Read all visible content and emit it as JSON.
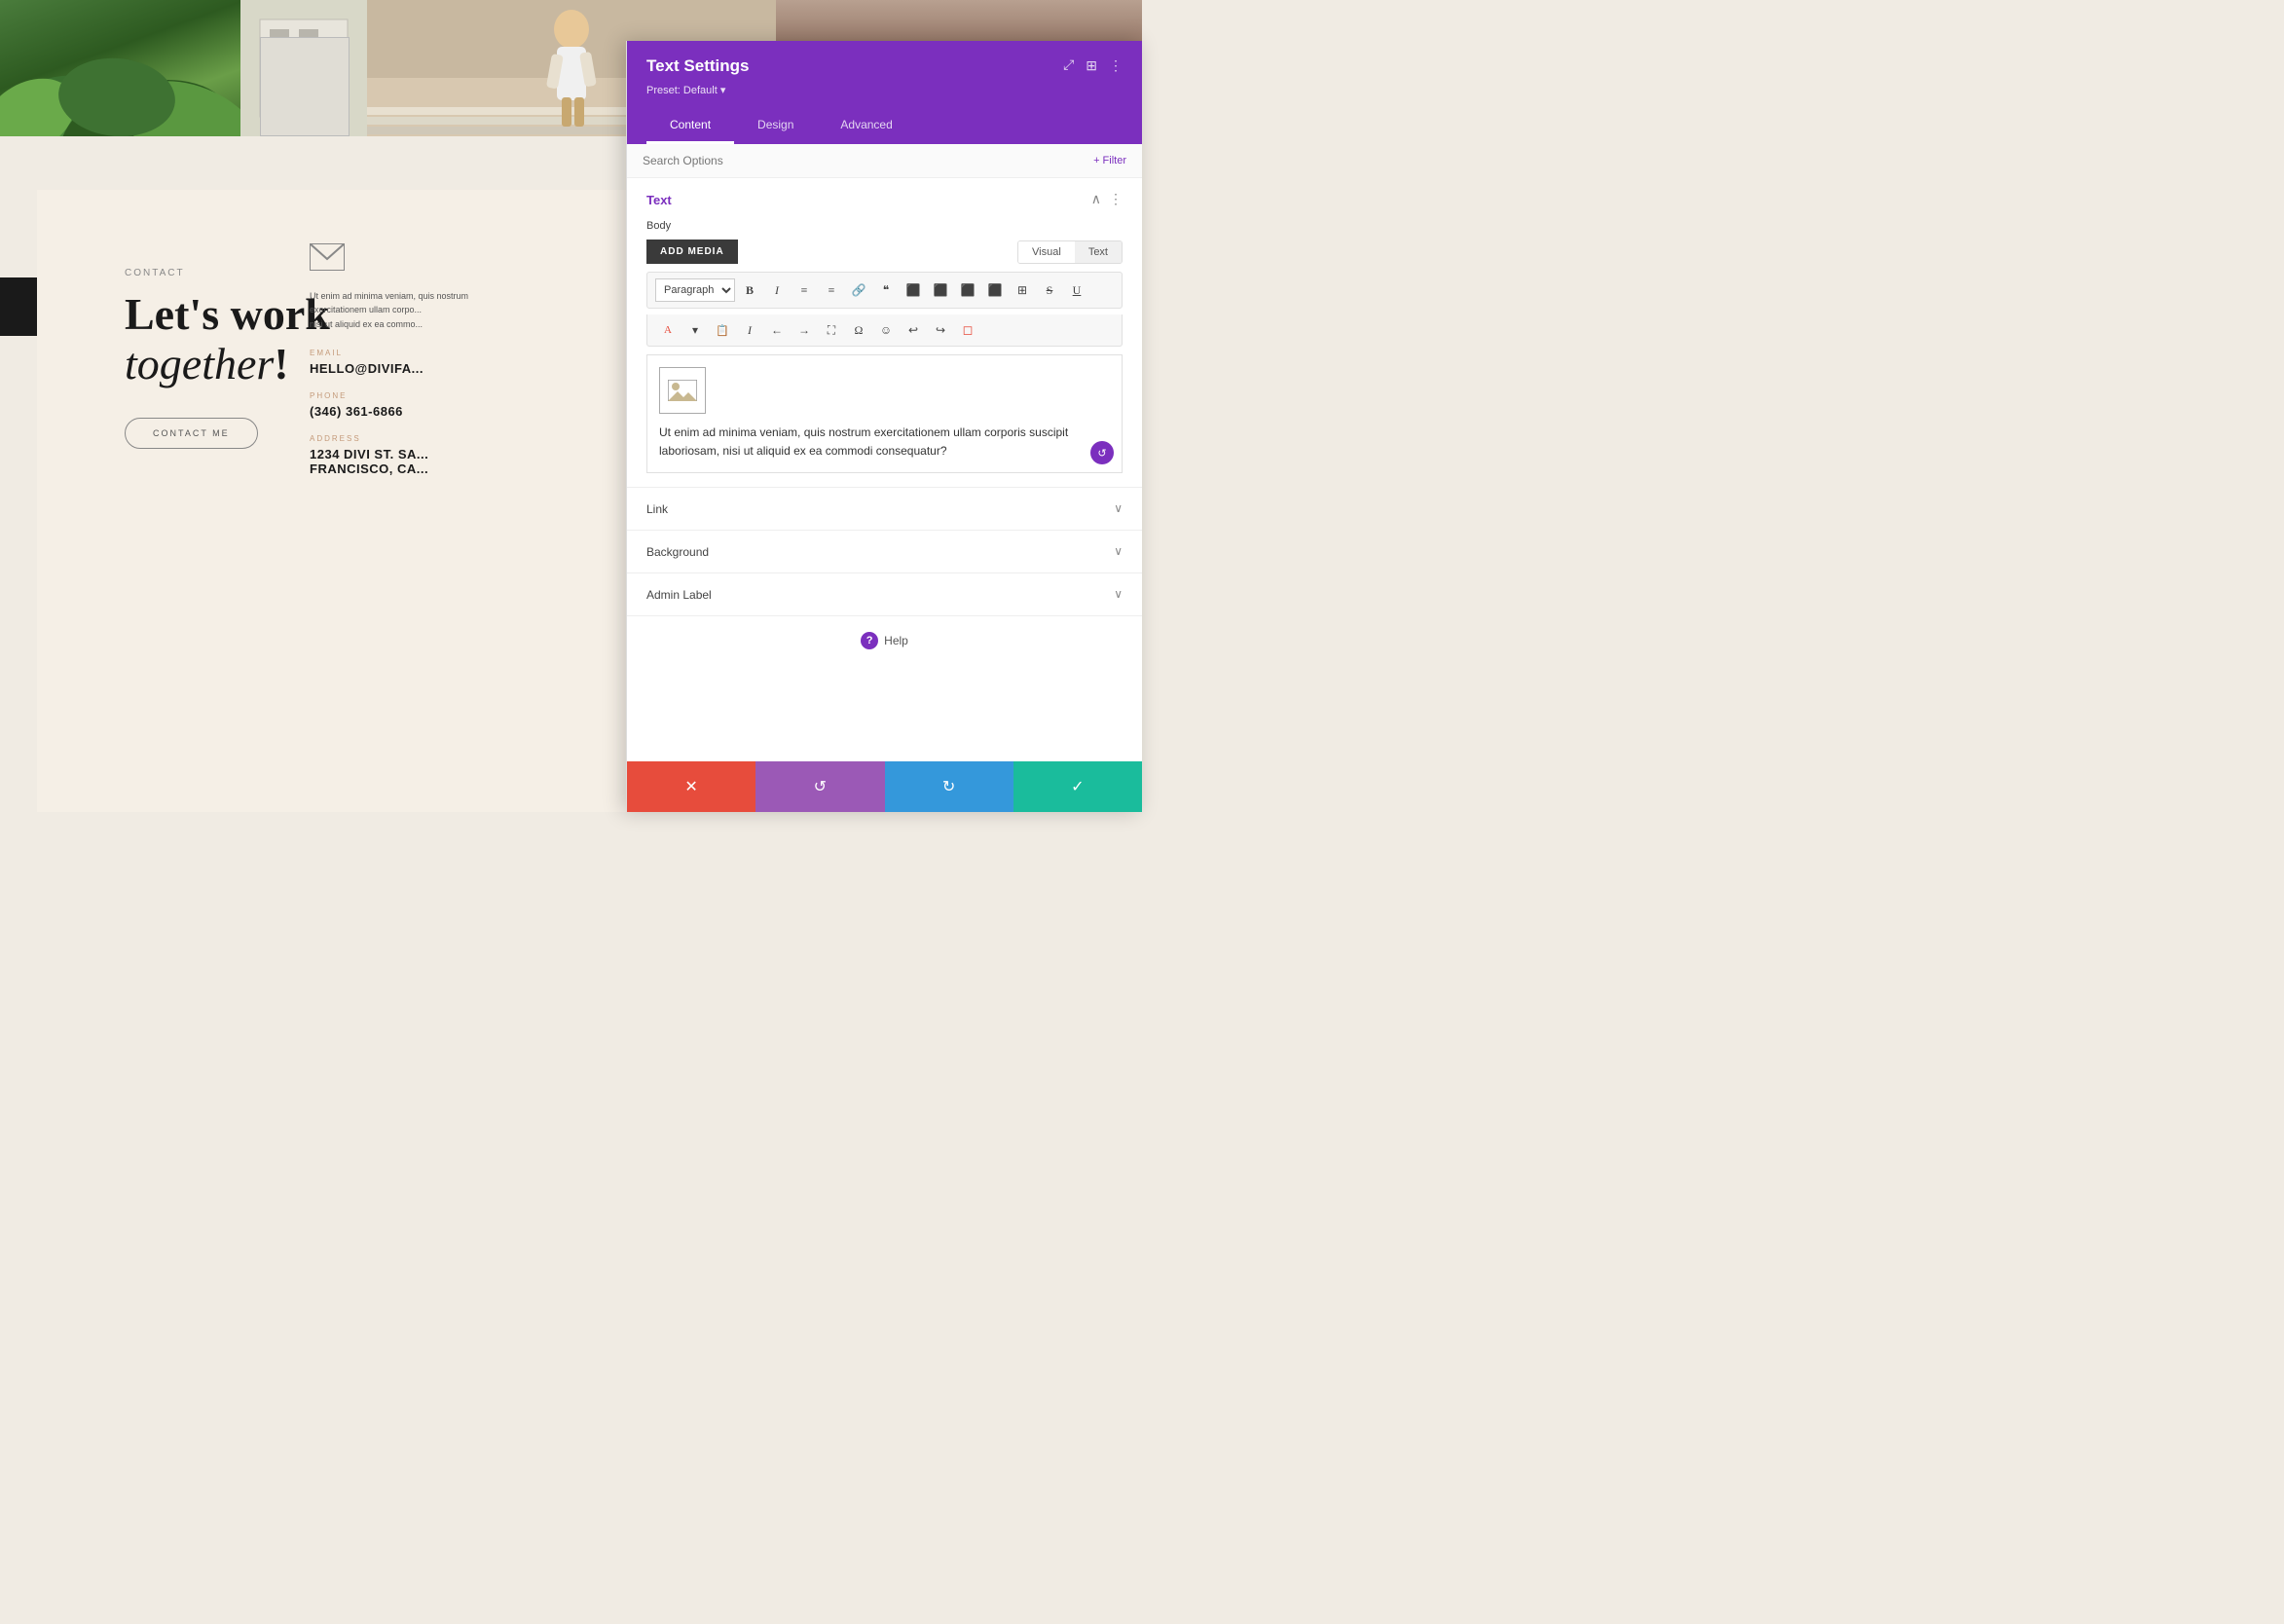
{
  "website": {
    "top_images": {
      "plant_alt": "tropical plants",
      "building_alt": "white building",
      "person_alt": "woman on steps"
    },
    "contact": {
      "label": "CONTACT",
      "heading_line1": "Let's work",
      "heading_line2": "together",
      "heading_punctuation": "!",
      "button_text": "CONTACT ME",
      "envelope_alt": "envelope icon",
      "body_text": "Ut enim ad minima veniam, quis nostrum exercitationem ullam corpo... nisi ut aliquid ex ea commo...",
      "email_label": "EMAIL",
      "email_value": "HELLO@DIVIFA...",
      "phone_label": "PHONE",
      "phone_value": "(346) 361-6866",
      "address_label": "ADDRESS",
      "address_line1": "1234 DIVI ST. SA...",
      "address_line2": "FRANCISCO, CA..."
    }
  },
  "panel": {
    "title": "Text Settings",
    "preset_label": "Preset: Default",
    "tabs": [
      {
        "id": "content",
        "label": "Content",
        "active": true
      },
      {
        "id": "design",
        "label": "Design",
        "active": false
      },
      {
        "id": "advanced",
        "label": "Advanced",
        "active": false
      }
    ],
    "search_placeholder": "Search Options",
    "filter_label": "+ Filter",
    "text_section": {
      "title": "Text",
      "body_label": "Body",
      "add_media_btn": "ADD MEDIA",
      "visual_label": "Visual",
      "text_label": "Text",
      "toolbar": {
        "paragraph_select": "Paragraph",
        "bold": "B",
        "italic": "I",
        "unordered_list": "≡",
        "ordered_list": "≡",
        "link": "🔗",
        "blockquote": "❝",
        "align_left": "⬛",
        "align_center": "⬛",
        "align_right": "⬛",
        "table": "⊞",
        "strikethrough": "S̶",
        "underline": "U̲"
      },
      "editor_content": "Ut enim ad minima veniam, quis nostrum exercitationem ullam corporis suscipit laboriosam, nisi ut aliquid ex ea commodi consequatur?"
    },
    "link_section": "Link",
    "background_section": "Background",
    "admin_label_section": "Admin Label",
    "help_text": "Help",
    "bottom_bar": {
      "cancel_icon": "✕",
      "reset_icon": "↺",
      "redo_icon": "↻",
      "save_icon": "✓"
    }
  },
  "colors": {
    "purple": "#7b2fbe",
    "cancel_red": "#e74c3c",
    "reset_purple": "#9b59b6",
    "redo_blue": "#3498db",
    "save_teal": "#1abc9c"
  }
}
